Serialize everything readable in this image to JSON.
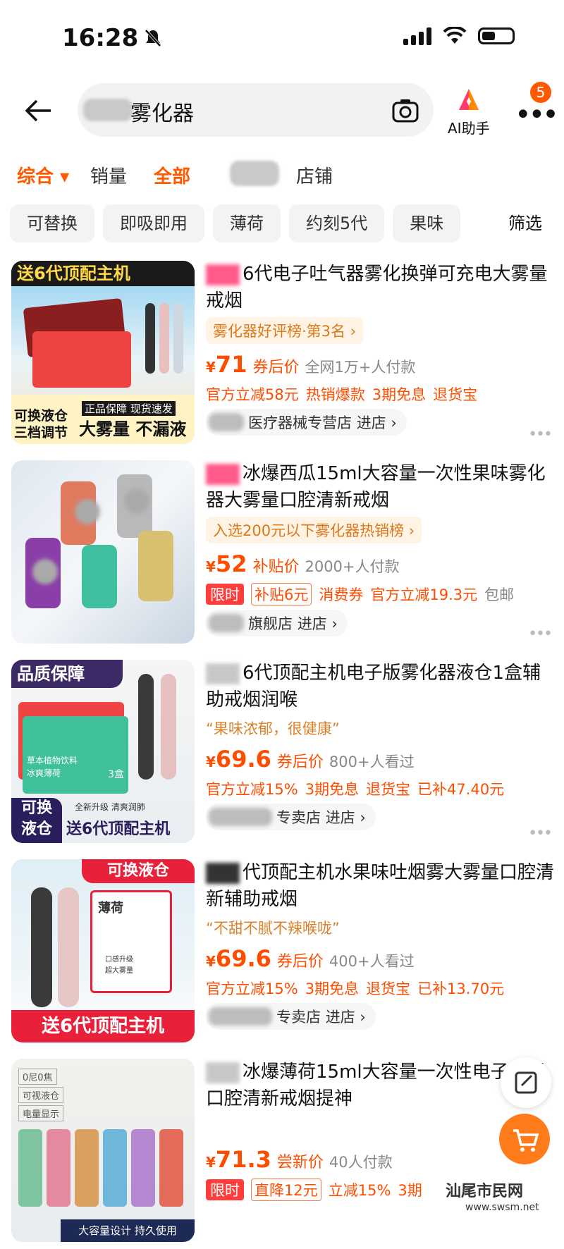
{
  "status": {
    "time": "16:28"
  },
  "search": {
    "query": "雾化器"
  },
  "header": {
    "ai_label": "AI助手",
    "badge_count": "5"
  },
  "sort": {
    "items": [
      "综合",
      "销量",
      "全部",
      "店铺"
    ]
  },
  "chips": [
    "可替换",
    "即吸即用",
    "薄荷",
    "约刻5代",
    "果味"
  ],
  "filter_label": "筛选",
  "products": [
    {
      "title": "6代电子吐气器雾化换弹可充电大雾量戒烟",
      "rank": "雾化器好评榜·第3名 ›",
      "price": "71",
      "price_label": "券后价",
      "sold": "全网1万+人付款",
      "promos": [
        "官方立减58元",
        "热销爆款",
        "3期免息",
        "退货宝"
      ],
      "shop": "医疗器械专营店",
      "enter": "进店 ›",
      "thumb": {
        "top_banner": "送6代顶配主机",
        "left_badge": "可换液仓\n三档调节",
        "tag": "正品保障 现货速发",
        "bottom": "大雾量 不漏液"
      }
    },
    {
      "title": "冰爆西瓜15ml大容量一次性果味雾化器大雾量口腔清新戒烟",
      "rank": "入选200元以下雾化器热销榜 ›",
      "price": "52",
      "price_label": "补贴价",
      "sold": "2000+人付款",
      "limit_tag": "限时",
      "subsidy": "补贴6元",
      "promos": [
        "消费券",
        "官方立减19.3元",
        "包邮"
      ],
      "shop": "旗舰店",
      "enter": "进店 ›"
    },
    {
      "title": "6代顶配主机电子版雾化器液仓1盒辅助戒烟润喉",
      "quote": "“果味浓郁，很健康”",
      "price": "69.6",
      "price_label": "券后价",
      "sold": "800+人看过",
      "promos": [
        "官方立减15%",
        "3期免息",
        "退货宝",
        "已补47.40元"
      ],
      "shop": "专卖店",
      "enter": "进店 ›",
      "thumb": {
        "top_banner": "品质保障",
        "left_badge": "可换\n液仓",
        "bottom": "送6代顶配主机",
        "small": "全新升级 清爽润肺",
        "box_label": "冰爽薄荷",
        "box_count": "3盒",
        "box_sub": "草本植物饮料"
      }
    },
    {
      "title": "代顶配主机水果味吐烟雾大雾量口腔清新辅助戒烟",
      "quote": "“不甜不腻不辣喉咙”",
      "price": "69.6",
      "price_label": "券后价",
      "sold": "400+人看过",
      "promos": [
        "官方立减15%",
        "3期免息",
        "退货宝",
        "已补13.70元"
      ],
      "shop": "专卖店",
      "enter": "进店 ›",
      "thumb": {
        "top_banner": "可换液仓",
        "box_label": "薄荷",
        "bottom": "送6代顶配主机",
        "box_feat1": "口感升级",
        "box_feat2": "超大雾量"
      }
    },
    {
      "title": "冰爆薄荷15ml大容量一次性电子化器口腔清新戒烟提神",
      "price": "71.3",
      "price_label": "尝新价",
      "sold": "40人付款",
      "limit_tag": "限时",
      "subsidy": "直降12元",
      "promos": [
        "立减15%",
        "3期"
      ],
      "thumb": {
        "feat1": "0尼0焦",
        "feat2": "可视液仓",
        "feat3": "电量显示",
        "bottom": "大容量设计 持久使用"
      }
    }
  ],
  "watermark": {
    "text": "汕尾市民网",
    "url": "www.swsm.net"
  },
  "colors": {
    "accent": "#ff5a00",
    "price": "#ff4d00",
    "chip_bg": "#f3f3f3"
  }
}
